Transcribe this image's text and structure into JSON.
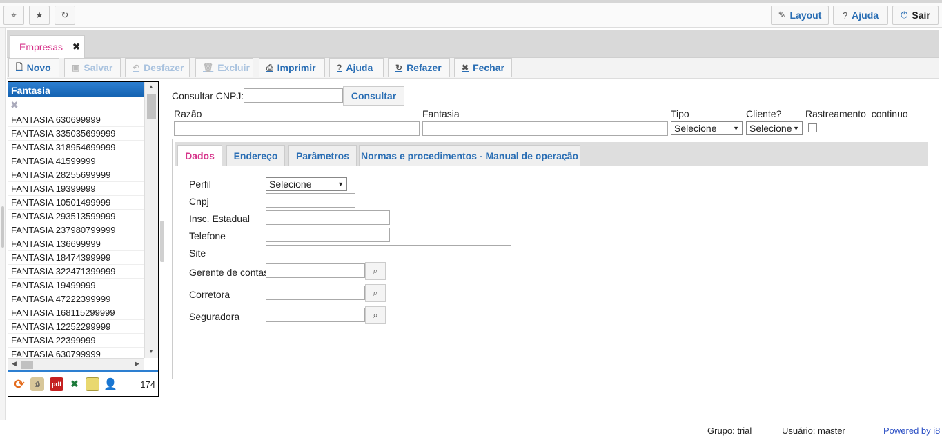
{
  "topbar": {
    "pin_icon": "pin-icon",
    "star_icon": "star-icon",
    "refresh_icon": "refresh-icon",
    "layout_label": "Layout",
    "help_label": "Ajuda",
    "exit_label": "Sair"
  },
  "tabs": {
    "main_tab_label": "Empresas",
    "close_glyph": "✖"
  },
  "actions": {
    "novo": "Novo",
    "salvar": "Salvar",
    "desfazer": "Desfazer",
    "excluir": "Excluir",
    "imprimir": "Imprimir",
    "ajuda": "Ajuda",
    "refazer": "Refazer",
    "fechar": "Fechar"
  },
  "grid": {
    "column_header": "Fantasia",
    "rows": [
      "FANTASIA 630699999",
      "FANTASIA 335035699999",
      "FANTASIA 318954699999",
      "FANTASIA 41599999",
      "FANTASIA 28255699999",
      "FANTASIA 19399999",
      "FANTASIA 10501499999",
      "FANTASIA 293513599999",
      "FANTASIA 237980799999",
      "FANTASIA 136699999",
      "FANTASIA 18474399999",
      "FANTASIA 322471399999",
      "FANTASIA 19499999",
      "FANTASIA 47222399999",
      "FANTASIA 168115299999",
      "FANTASIA 12252299999",
      "FANTASIA 22399999",
      "FANTASIA 630799999"
    ],
    "pdf_label": "pdf",
    "record_count": "174"
  },
  "form": {
    "consultar_cnpj_label": "Consultar CNPJ:",
    "consultar_cnpj_value": "",
    "consultar_button": "Consultar",
    "razao_label": "Razão",
    "fantasia_label": "Fantasia",
    "tipo_label": "Tipo",
    "tipo_value": "Selecione",
    "cliente_label": "Cliente?",
    "cliente_value": "Selecione",
    "rastreamento_label": "Rastreamento_continuo"
  },
  "inner_tabs": {
    "dados": "Dados",
    "endereco": "Endereço",
    "parametros": "Parâmetros",
    "normas": "Normas e procedimentos - Manual de operação"
  },
  "dados": {
    "perfil_label": "Perfil",
    "perfil_value": "Selecione",
    "cnpj_label": "Cnpj",
    "insc_label": "Insc. Estadual",
    "telefone_label": "Telefone",
    "site_label": "Site",
    "gerente_label": "Gerente de contas",
    "corretora_label": "Corretora",
    "seguradora_label": "Seguradora"
  },
  "footer": {
    "grupo": "Grupo: trial",
    "usuario": "Usuário: master",
    "powered": "Powered by i8"
  },
  "colors": {
    "accent_blue": "#2a6eb4",
    "active_tab_pink": "#d6338a",
    "grid_header_blue": "#1a6fc2"
  }
}
